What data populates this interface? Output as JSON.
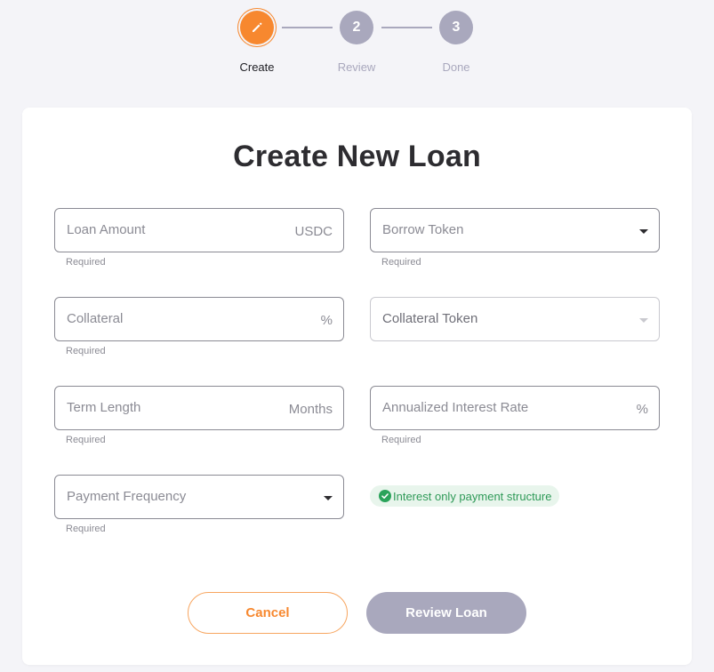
{
  "stepper": {
    "steps": [
      {
        "number": "",
        "label": "Create",
        "icon": "pencil-icon"
      },
      {
        "number": "2",
        "label": "Review"
      },
      {
        "number": "3",
        "label": "Done"
      }
    ]
  },
  "form": {
    "title": "Create New Loan",
    "loan_amount": {
      "placeholder": "Loan Amount",
      "adornment": "USDC",
      "helper": "Required"
    },
    "borrow_token": {
      "placeholder": "Borrow Token",
      "helper": "Required"
    },
    "collateral": {
      "placeholder": "Collateral",
      "adornment": "%",
      "helper": "Required"
    },
    "collateral_token": {
      "placeholder": "Collateral Token"
    },
    "term_length": {
      "placeholder": "Term Length",
      "adornment": "Months",
      "helper": "Required"
    },
    "interest_rate": {
      "placeholder": "Annualized Interest Rate",
      "adornment": "%",
      "helper": "Required"
    },
    "payment_frequency": {
      "placeholder": "Payment Frequency",
      "helper": "Required"
    },
    "info_chip": {
      "text": "Interest only payment structure",
      "icon": "check-circle-icon"
    }
  },
  "actions": {
    "cancel_label": "Cancel",
    "review_label": "Review Loan"
  },
  "colors": {
    "accent": "#f7882f",
    "inactive": "#a9a8bd",
    "success": "#2aa35a"
  }
}
